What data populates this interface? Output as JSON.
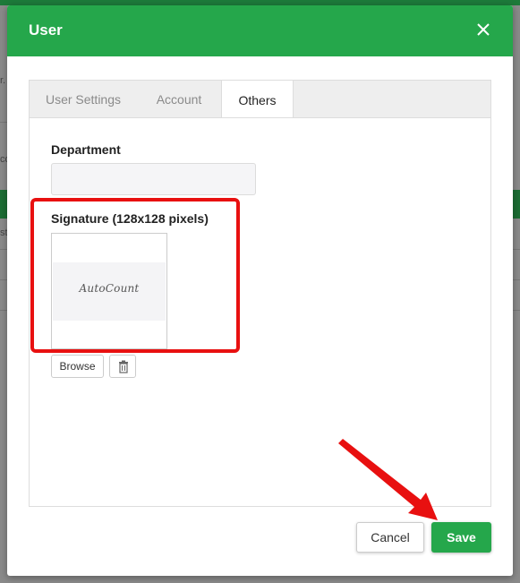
{
  "dialog": {
    "title": "User",
    "close_icon": "close-icon"
  },
  "tabs": [
    {
      "label": "User Settings",
      "active": false
    },
    {
      "label": "Account",
      "active": false
    },
    {
      "label": "Others",
      "active": true
    }
  ],
  "form": {
    "department": {
      "label": "Department",
      "value": ""
    },
    "signature": {
      "label": "Signature (128x128 pixels)",
      "image_text": "AutoCount",
      "browse_label": "Browse",
      "delete_icon": "trash-icon"
    }
  },
  "footer": {
    "cancel_label": "Cancel",
    "save_label": "Save"
  },
  "background": {
    "fragments": [
      "r.",
      "co",
      "st"
    ]
  },
  "colors": {
    "header": "#25a74b",
    "save": "#25a74b",
    "annotation": "#e81010"
  }
}
